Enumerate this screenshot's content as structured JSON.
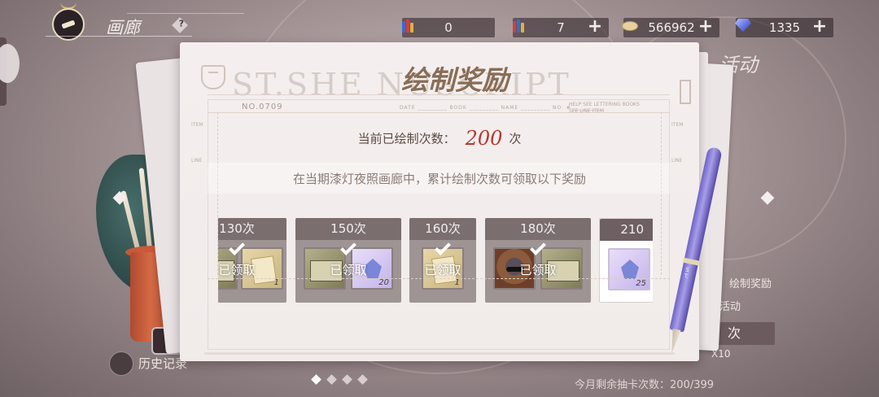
{
  "header": {
    "title": "画廊",
    "help_symbol": "?"
  },
  "resources": [
    {
      "name": "paint-tube-blue",
      "value": "0",
      "has_plus": false
    },
    {
      "name": "paint-tube-red",
      "value": "7",
      "has_plus": true
    },
    {
      "name": "coin",
      "value": "566962",
      "has_plus": true
    },
    {
      "name": "diamond",
      "value": "1335",
      "has_plus": true
    }
  ],
  "panel": {
    "title": "绘制奖励",
    "watermark": "ST.SHE            NUSCRIPT",
    "form_no": "NO.0709",
    "count_label": "当前已绘制次数：",
    "count_value": "200",
    "count_unit": "次",
    "description": "在当期漆灯夜照画廊中，累计绘制次数可领取以下奖励"
  },
  "rewards": [
    {
      "label": "130次",
      "claimed": true,
      "claimed_text": "已领取",
      "items": [
        "machine",
        "paper"
      ],
      "nums": [
        "",
        "1"
      ]
    },
    {
      "label": "150次",
      "claimed": true,
      "claimed_text": "已领取",
      "items": [
        "machine",
        "fairy"
      ],
      "nums": [
        "",
        "20"
      ]
    },
    {
      "label": "160次",
      "claimed": true,
      "claimed_text": "已领取",
      "items": [
        "paper"
      ],
      "nums": [
        "1"
      ]
    },
    {
      "label": "180次",
      "claimed": true,
      "claimed_text": "已领取",
      "items": [
        "avatar",
        "machine"
      ],
      "nums": [
        "",
        ""
      ]
    },
    {
      "label": "210",
      "claimed": false,
      "claimed_text": "",
      "items": [
        "fairy"
      ],
      "nums": [
        "25"
      ]
    }
  ],
  "background": {
    "activity_label": "活动",
    "side_text_1": "绘制奖励",
    "side_text_2": "活动",
    "ci_button": "次",
    "x10_label": "X10",
    "month_remaining": "今月剩余抽卡次数：200/399",
    "history_label": "历史记录"
  },
  "pen": {
    "label": "ST."
  },
  "colors": {
    "accent_red": "#b5362f",
    "panel_bg": "#f4efee",
    "card_head": "#7b6e6f",
    "title_brown": "#8a6d56"
  }
}
